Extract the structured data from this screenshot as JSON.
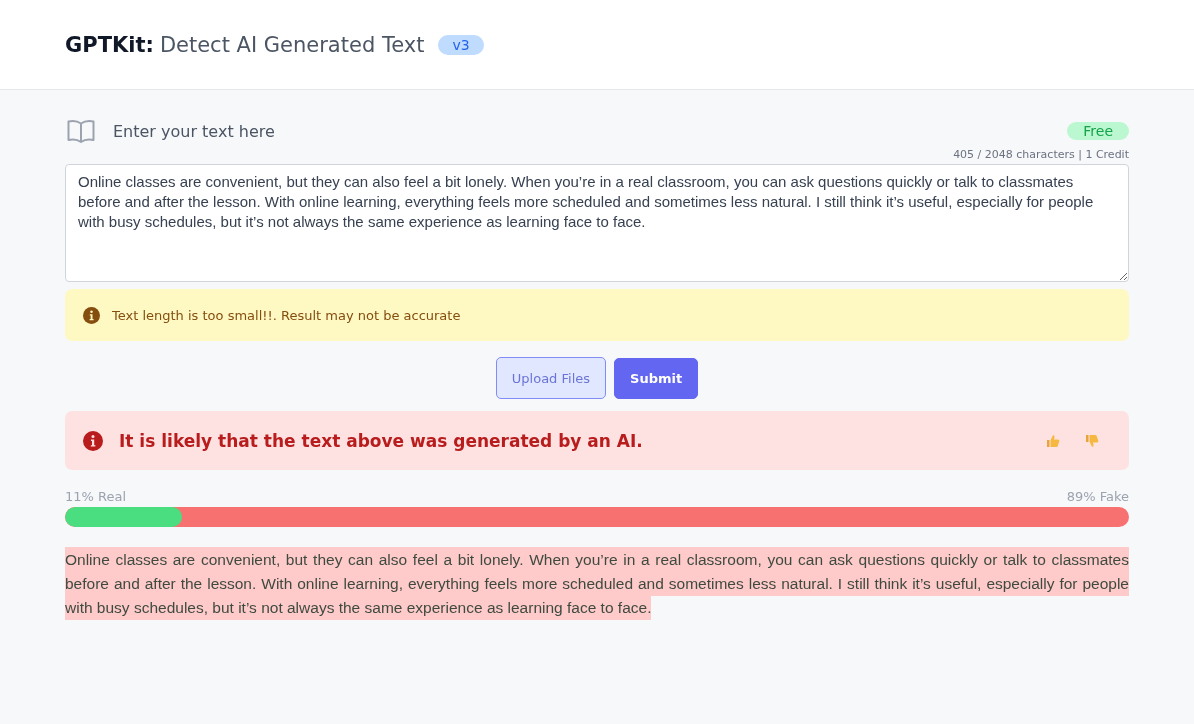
{
  "header": {
    "brand": "GPTKit:",
    "title": "Detect AI Generated Text",
    "version": "v3"
  },
  "input": {
    "heading": "Enter your text here",
    "plan": "Free",
    "counter": "405 / 2048 characters | 1 Credit",
    "value": "Online classes are convenient, but they can also feel a bit lonely. When you’re in a real classroom, you can ask questions quickly or talk to classmates before and after the lesson. With online learning, everything feels more scheduled and sometimes less natural. I still think it’s useful, especially for people with busy schedules, but it’s not always the same experience as learning face to face."
  },
  "warning": {
    "message": "Text length is too small!!. Result may not be accurate"
  },
  "buttons": [
    {
      "label": "Upload Files",
      "kind": "secondary"
    },
    {
      "label": "Submit",
      "kind": "primary"
    }
  ],
  "result": {
    "message": "It is likely that the text above was generated by an AI.",
    "kind": "ai"
  },
  "meter": {
    "real_label": "11% Real",
    "fake_label": "89% Fake",
    "level": 0.11
  },
  "analysis": [
    {
      "text": "Online classes are convenient, but they can also feel a bit lonely. When you’re in a real classroom, you can ask questions quickly or talk to classmates before and after the lesson. With online learning, everything feels more scheduled and sometimes less natural. I still think it’s useful, especially for people with busy schedules, but it’s not always the same experience as learning face to face.",
      "kind": "ai"
    }
  ]
}
